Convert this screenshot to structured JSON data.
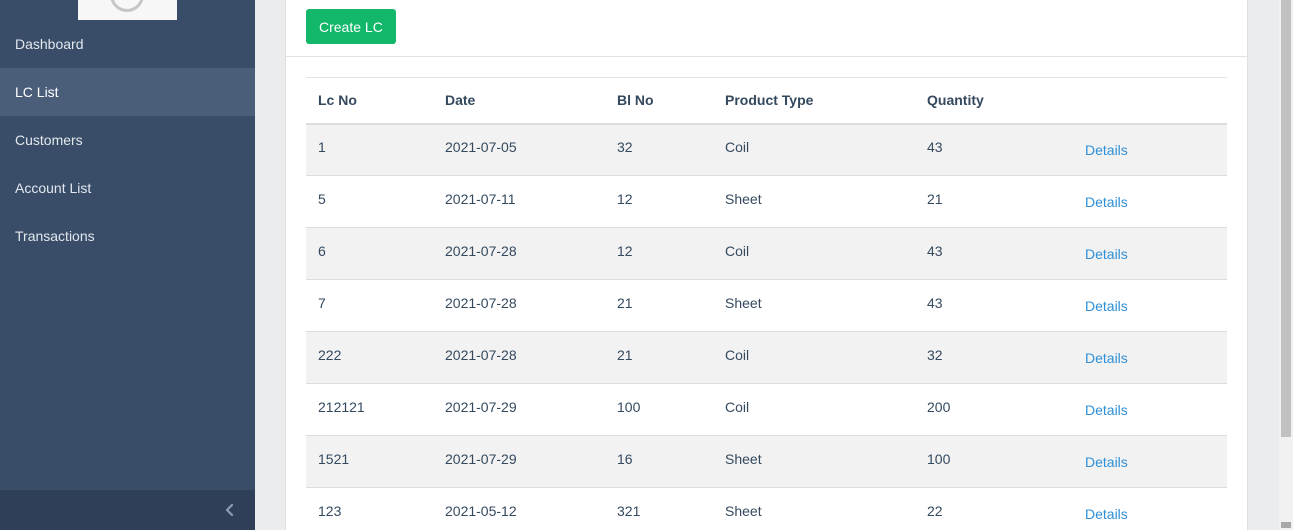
{
  "sidebar": {
    "items": [
      {
        "label": "Dashboard"
      },
      {
        "label": "LC List"
      },
      {
        "label": "Customers"
      },
      {
        "label": "Account List"
      },
      {
        "label": "Transactions"
      }
    ],
    "active_index": 1,
    "collapse_icon": "chevron-left-icon"
  },
  "toolbar": {
    "create_label": "Create LC"
  },
  "table": {
    "headers": {
      "lc_no": "Lc No",
      "date": "Date",
      "bl_no": "Bl No",
      "product_type": "Product Type",
      "quantity": "Quantity",
      "action": ""
    },
    "rows": [
      {
        "lc_no": "1",
        "date": "2021-07-05",
        "bl_no": "32",
        "product_type": "Coil",
        "quantity": "43",
        "action": "Details"
      },
      {
        "lc_no": "5",
        "date": "2021-07-11",
        "bl_no": "12",
        "product_type": "Sheet",
        "quantity": "21",
        "action": "Details"
      },
      {
        "lc_no": "6",
        "date": "2021-07-28",
        "bl_no": "12",
        "product_type": "Coil",
        "quantity": "43",
        "action": "Details"
      },
      {
        "lc_no": "7",
        "date": "2021-07-28",
        "bl_no": "21",
        "product_type": "Sheet",
        "quantity": "43",
        "action": "Details"
      },
      {
        "lc_no": "222",
        "date": "2021-07-28",
        "bl_no": "21",
        "product_type": "Coil",
        "quantity": "32",
        "action": "Details"
      },
      {
        "lc_no": "212121",
        "date": "2021-07-29",
        "bl_no": "100",
        "product_type": "Coil",
        "quantity": "200",
        "action": "Details"
      },
      {
        "lc_no": "1521",
        "date": "2021-07-29",
        "bl_no": "16",
        "product_type": "Sheet",
        "quantity": "100",
        "action": "Details"
      },
      {
        "lc_no": "123",
        "date": "2021-05-12",
        "bl_no": "321",
        "product_type": "Sheet",
        "quantity": "22",
        "action": "Details"
      }
    ]
  },
  "colors": {
    "sidebar_bg": "#3a4d68",
    "sidebar_active": "#4a5d79",
    "primary_button": "#12b76a",
    "link": "#2f8fd8"
  }
}
